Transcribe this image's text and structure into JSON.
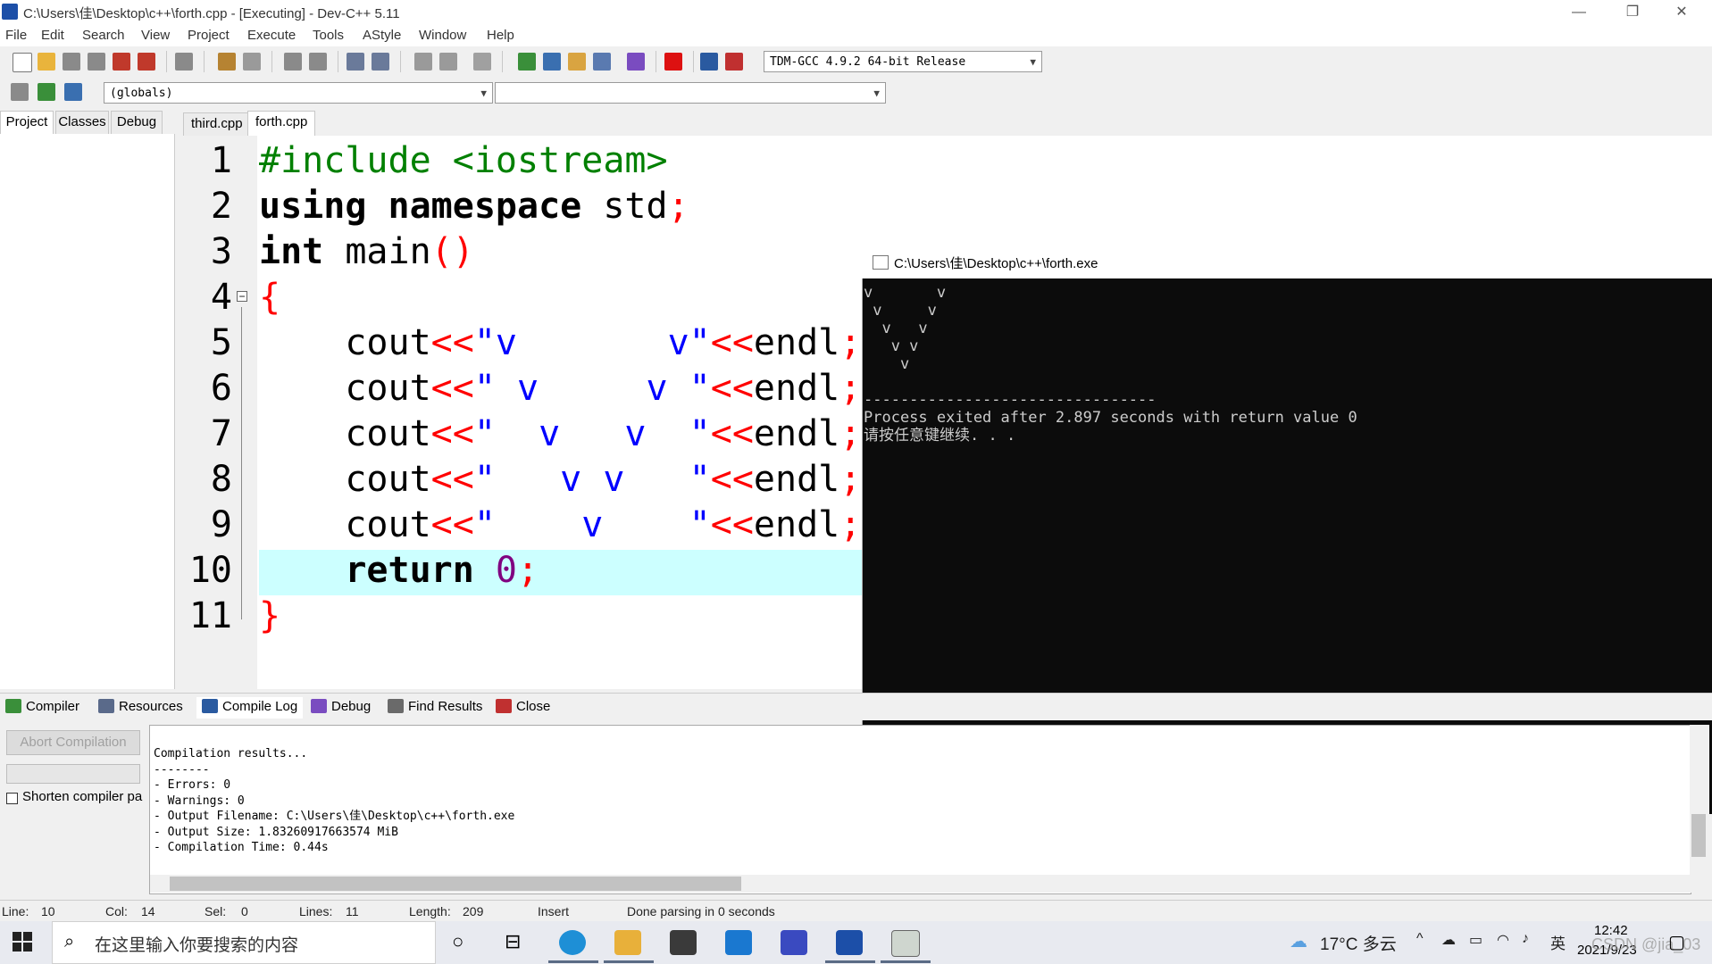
{
  "window": {
    "title": "C:\\Users\\佳\\Desktop\\c++\\forth.cpp - [Executing] - Dev-C++ 5.11",
    "minimize": "—",
    "maximize": "❐",
    "close": "✕"
  },
  "menu": [
    "File",
    "Edit",
    "Search",
    "View",
    "Project",
    "Execute",
    "Tools",
    "AStyle",
    "Window",
    "Help"
  ],
  "toolbar": {
    "compiler_select": "TDM-GCC 4.9.2 64-bit Release",
    "scope_select": "(globals)",
    "member_select": ""
  },
  "left_tabs": [
    "Project",
    "Classes",
    "Debug"
  ],
  "editor_tabs": [
    "third.cpp",
    "forth.cpp"
  ],
  "editor": {
    "line_numbers": [
      "1",
      "2",
      "3",
      "4",
      "5",
      "6",
      "7",
      "8",
      "9",
      "10",
      "11"
    ],
    "lines": [
      [
        {
          "t": "#include <iostream>",
          "c": "pp"
        }
      ],
      [
        {
          "t": "using namespace",
          "c": "kw"
        },
        {
          "t": " std",
          "c": ""
        },
        {
          "t": ";",
          "c": "sym"
        }
      ],
      [
        {
          "t": "int",
          "c": "kw"
        },
        {
          "t": " main",
          "c": ""
        },
        {
          "t": "()",
          "c": "sym"
        }
      ],
      [
        {
          "t": "{",
          "c": "sym"
        }
      ],
      [
        {
          "t": "    cout",
          "c": ""
        },
        {
          "t": "<<",
          "c": "sym"
        },
        {
          "t": "\"v       v\"",
          "c": "str"
        },
        {
          "t": "<<",
          "c": "sym"
        },
        {
          "t": "endl",
          "c": ""
        },
        {
          "t": ";",
          "c": "sym"
        }
      ],
      [
        {
          "t": "    cout",
          "c": ""
        },
        {
          "t": "<<",
          "c": "sym"
        },
        {
          "t": "\" v     v \"",
          "c": "str"
        },
        {
          "t": "<<",
          "c": "sym"
        },
        {
          "t": "endl",
          "c": ""
        },
        {
          "t": ";",
          "c": "sym"
        }
      ],
      [
        {
          "t": "    cout",
          "c": ""
        },
        {
          "t": "<<",
          "c": "sym"
        },
        {
          "t": "\"  v   v  \"",
          "c": "str"
        },
        {
          "t": "<<",
          "c": "sym"
        },
        {
          "t": "endl",
          "c": ""
        },
        {
          "t": ";",
          "c": "sym"
        }
      ],
      [
        {
          "t": "    cout",
          "c": ""
        },
        {
          "t": "<<",
          "c": "sym"
        },
        {
          "t": "\"   v v   \"",
          "c": "str"
        },
        {
          "t": "<<",
          "c": "sym"
        },
        {
          "t": "endl",
          "c": ""
        },
        {
          "t": ";",
          "c": "sym"
        }
      ],
      [
        {
          "t": "    cout",
          "c": ""
        },
        {
          "t": "<<",
          "c": "sym"
        },
        {
          "t": "\"    v    \"",
          "c": "str"
        },
        {
          "t": "<<",
          "c": "sym"
        },
        {
          "t": "endl",
          "c": ""
        },
        {
          "t": ";",
          "c": "sym"
        }
      ],
      [
        {
          "t": "    return",
          "c": "kw"
        },
        {
          "t": " ",
          "c": ""
        },
        {
          "t": "0",
          "c": "num"
        },
        {
          "t": ";",
          "c": "sym"
        }
      ],
      [
        {
          "t": "}",
          "c": "sym"
        }
      ]
    ]
  },
  "console": {
    "title": "C:\\Users\\佳\\Desktop\\c++\\forth.exe",
    "lines": [
      "v       v",
      " v     v",
      "  v   v",
      "   v v",
      "    v",
      "",
      "--------------------------------",
      "Process exited after 2.897 seconds with return value 0",
      "请按任意键继续. . ."
    ]
  },
  "bottom_tabs": [
    "Compiler",
    "Resources",
    "Compile Log",
    "Debug",
    "Find Results",
    "Close"
  ],
  "bottom_left": {
    "abort_button": "Abort Compilation",
    "shorten_label": "Shorten compiler pa"
  },
  "compile_log": [
    "Compilation results...",
    "--------",
    "- Errors: 0",
    "- Warnings: 0",
    "- Output Filename: C:\\Users\\佳\\Desktop\\c++\\forth.exe",
    "- Output Size: 1.83260917663574 MiB",
    "- Compilation Time: 0.44s"
  ],
  "status": {
    "line_label": "Line:",
    "line_value": "10",
    "col_label": "Col:",
    "col_value": "14",
    "sel_label": "Sel:",
    "sel_value": "0",
    "lines_label": "Lines:",
    "lines_value": "11",
    "length_label": "Length:",
    "length_value": "209",
    "mode": "Insert",
    "message": "Done parsing in 0 seconds"
  },
  "taskbar": {
    "search_placeholder": "在这里输入你要搜索的内容",
    "weather": "17°C 多云",
    "ime": "英",
    "time": "12:42",
    "date": "2021/9/23",
    "watermark": "CSDN @jia_03"
  },
  "colors": {
    "keyword": "#000000",
    "preprocessor": "#008000",
    "symbol": "#ff0000",
    "string": "#0000ff",
    "number": "#800080",
    "current_line": "#ccffff"
  }
}
